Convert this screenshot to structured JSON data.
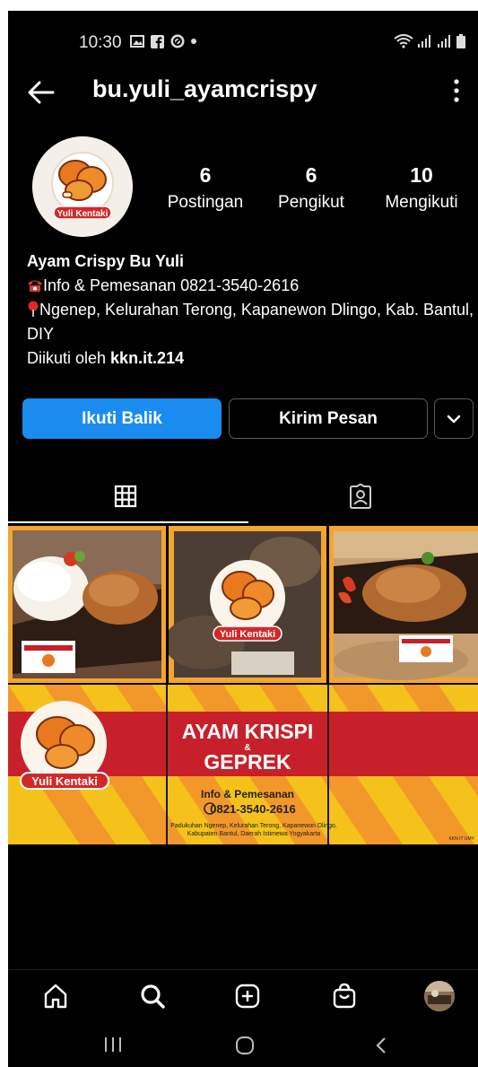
{
  "status_bar": {
    "time": "10:30"
  },
  "header": {
    "username": "bu.yuli_ayamcrispy"
  },
  "profile": {
    "stats": [
      {
        "value": "6",
        "label": "Postingan"
      },
      {
        "value": "6",
        "label": "Pengikut"
      },
      {
        "value": "10",
        "label": "Mengikuti"
      }
    ],
    "name": "Ayam Crispy Bu Yuli",
    "bio_line_phone": "Info & Pemesanan 0821-3540-2616",
    "bio_line_address": "Ngenep, Kelurahan Terong, Kapanewon Dlingo, Kab. Bantul, DIY",
    "followed_by_prefix": "Diikuti oleh ",
    "followed_by_user": "kkn.it.214"
  },
  "buttons": {
    "follow_back": "Ikuti Balik",
    "send_message": "Kirim Pesan"
  },
  "logo_text": "Yuli Kentaki",
  "banner": {
    "headline_1": "AYAM KRISPI",
    "amp": "&",
    "headline_2": "GEPREK",
    "info_label": "Info & Pemesanan",
    "phone": "0821-3540-2616",
    "address_1": "Padukuhan Ngenep, Kelurahan Terong, Kapanewon Dlingo,",
    "address_2": "Kabupaten Bantul, Daerah Istimewa Yogyakarta",
    "credit": "KKN IT UMY"
  },
  "colors": {
    "accent": "#1a8cf0",
    "brand_orange": "#f2a530",
    "banner_red": "#c8202a",
    "banner_yellow": "#f5c21b"
  }
}
